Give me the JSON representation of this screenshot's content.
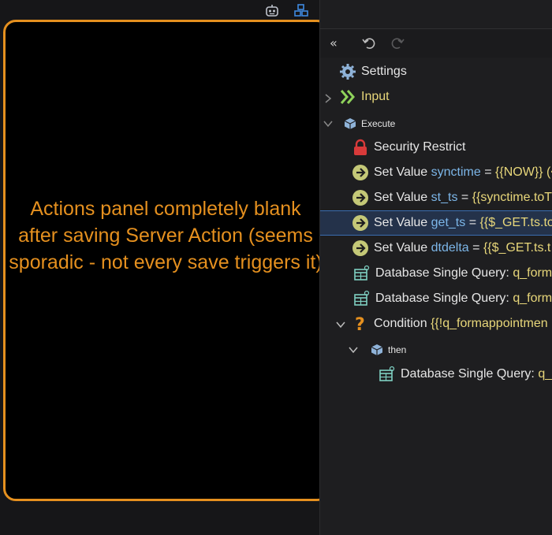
{
  "annotation": {
    "text": "Actions panel completely blank after saving Server Action (seems sporadic - not every save triggers it)",
    "color": "#e5901f"
  },
  "toolbar": {
    "collapse_icon": "double-chevron-left-icon",
    "undo_icon": "undo-icon",
    "redo_icon": "redo-icon"
  },
  "top_icons": [
    "robot-icon",
    "cubes-icon"
  ],
  "tree": {
    "settings_label": "Settings",
    "input_label": "Input",
    "execute_label": "Execute",
    "security_label": "Security Restrict",
    "set1": {
      "prefix": "Set Value",
      "var": "synctime",
      "op": "=",
      "val": "{{NOW}} (<"
    },
    "set2": {
      "prefix": "Set Value",
      "var": "st_ts",
      "op": "=",
      "val": "{{synctime.toT"
    },
    "set3": {
      "prefix": "Set Value",
      "var": "get_ts",
      "op": "=",
      "val": "{{$_GET.ts.to"
    },
    "set4": {
      "prefix": "Set Value",
      "var": "dtdelta",
      "op": "=",
      "val": "{{$_GET.ts.t"
    },
    "db1": {
      "prefix": "Database Single Query:",
      "name": "q_form"
    },
    "db2": {
      "prefix": "Database Single Query:",
      "name": "q_form"
    },
    "condition": {
      "prefix": "Condition",
      "expr": "{{!q_formappointmen"
    },
    "then_label": "then",
    "db3": {
      "prefix": "Database Single Query:",
      "name": "q_"
    }
  },
  "colors": {
    "accent": "#e5901f",
    "variable": "#7cb6e8",
    "value": "#e8d77a",
    "input_green": "#8fd35b",
    "setvalue_green": "#c4c877",
    "lock_red": "#d83a3a",
    "condition_orange": "#e5901f"
  }
}
